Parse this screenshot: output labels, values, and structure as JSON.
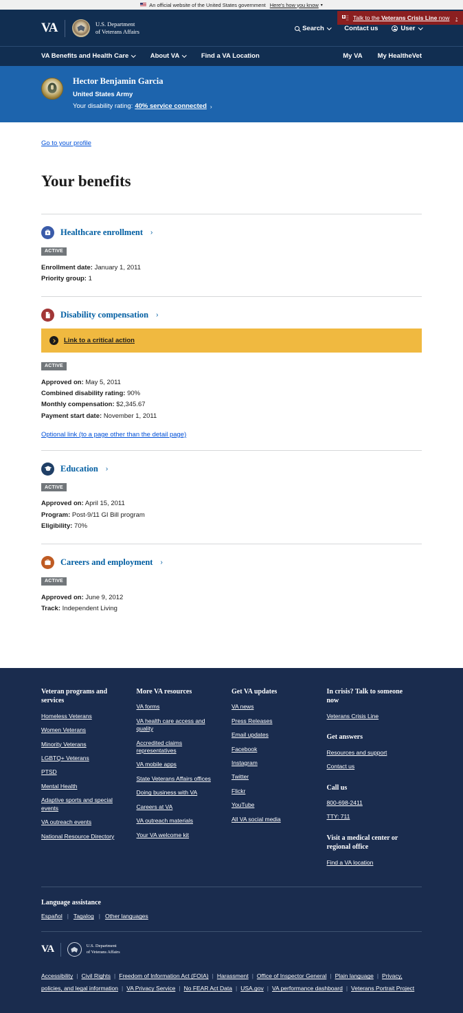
{
  "gov_banner": {
    "text": "An official website of the United States government",
    "hint": "Here's how you know",
    "flag_icon": "us-flag-icon",
    "caret_icon": "chevron-down-icon"
  },
  "crisis_line": {
    "prefix": "Talk to the",
    "emphasis": "Veterans Crisis Line",
    "suffix": "now",
    "icon": "crisis-line-icon",
    "chevron": "›",
    "color": "#8b1f20"
  },
  "header": {
    "logo_va": "VA",
    "seal_icon": "va-seal-icon",
    "logo_line1": "U.S. Department",
    "logo_line2": "of Veterans Affairs",
    "links": [
      {
        "label": "Search",
        "icon": "search-icon",
        "caret": true
      },
      {
        "label": "Contact us",
        "icon": null,
        "caret": false
      },
      {
        "label": "User",
        "icon": "user-icon",
        "caret": true
      }
    ],
    "nav_left": [
      {
        "label": "VA Benefits and Health Care",
        "caret": true
      },
      {
        "label": "About VA",
        "caret": true
      },
      {
        "label": "Find a VA Location",
        "caret": false
      }
    ],
    "nav_right": [
      {
        "label": "My VA"
      },
      {
        "label": "My HealtheVet"
      }
    ],
    "background": "#112e51"
  },
  "profile_banner": {
    "seal_icon": "army-seal-icon",
    "name": "Hector Benjamin Garcia",
    "branch": "United States Army",
    "rating_label": "Your disability rating:",
    "rating_link": "40% service connected",
    "chevron": "›",
    "background": "#1d64ad"
  },
  "main": {
    "profile_link": "Go to your profile",
    "page_title": "Your benefits",
    "benefits": [
      {
        "id": "healthcare-enrollment",
        "title": "Healthcare enrollment",
        "icon": "medical-bag-icon",
        "icon_color": "#3a5ba9",
        "chevron": "›",
        "status": "ACTIVE",
        "critical_action": null,
        "details": [
          {
            "key": "Enrollment date:",
            "value": "January 1, 2011"
          },
          {
            "key": "Priority group:",
            "value": "1"
          }
        ],
        "optional_link": null
      },
      {
        "id": "disability-compensation",
        "title": "Disability compensation",
        "icon": "document-icon",
        "icon_color": "#a23737",
        "chevron": "›",
        "status": "ACTIVE",
        "critical_action": {
          "label": "Link to a critical action",
          "icon": "chevron-right-circle-icon",
          "background": "#f0b940"
        },
        "details": [
          {
            "key": "Approved on:",
            "value": "May 5, 2011"
          },
          {
            "key": "Combined disability rating:",
            "value": "90%"
          },
          {
            "key": "Monthly compensation:",
            "value": "$2,345.67"
          },
          {
            "key": "Payment start date:",
            "value": "November 1, 2011"
          }
        ],
        "optional_link": "Optional link (to a page other than the detail page)"
      },
      {
        "id": "education",
        "title": "Education",
        "icon": "graduation-cap-icon",
        "icon_color": "#1f3f66",
        "chevron": "›",
        "status": "ACTIVE",
        "critical_action": null,
        "details": [
          {
            "key": "Approved on:",
            "value": "April 15, 2011"
          },
          {
            "key": "Program:",
            "value": "Post-9/11 GI Bill program"
          },
          {
            "key": "Eligibility:",
            "value": "70%"
          }
        ],
        "optional_link": null
      },
      {
        "id": "careers-and-employment",
        "title": "Careers and employment",
        "icon": "briefcase-icon",
        "icon_color": "#bf5b23",
        "chevron": "›",
        "status": "ACTIVE",
        "critical_action": null,
        "details": [
          {
            "key": "Approved on:",
            "value": "June 9, 2012"
          },
          {
            "key": "Track:",
            "value": "Independent Living"
          }
        ],
        "optional_link": null
      }
    ]
  },
  "footer": {
    "background": "#1a2c4e",
    "columns": [
      {
        "heading": "Veteran programs and services",
        "links": [
          "Homeless Veterans",
          "Women Veterans",
          "Minority Veterans",
          "LGBTQ+ Veterans",
          "PTSD",
          "Mental Health",
          "Adaptive sports and special events",
          "VA outreach events",
          "National Resource Directory"
        ]
      },
      {
        "heading": "More VA resources",
        "links": [
          "VA forms",
          "VA health care access and quality",
          "Accredited claims representatives",
          "VA mobile apps",
          "State Veterans Affairs offices",
          "Doing business with VA",
          "Careers at VA",
          "VA outreach materials",
          "Your VA welcome kit"
        ]
      },
      {
        "heading": "Get VA updates",
        "links": [
          "VA news",
          "Press Releases",
          "Email updates",
          "Facebook",
          "Instagram",
          "Twitter",
          "Flickr",
          "YouTube",
          "All VA social media"
        ]
      }
    ],
    "support_groups": [
      {
        "heading": "In crisis? Talk to someone now",
        "links": [
          "Veterans Crisis Line"
        ]
      },
      {
        "heading": "Get answers",
        "links": [
          "Resources and support",
          "Contact us"
        ]
      },
      {
        "heading": "Call us",
        "links": [
          "800-698-2411",
          "TTY: 711"
        ]
      },
      {
        "heading": "Visit a medical center or regional office",
        "links": [
          "Find a VA location"
        ]
      }
    ],
    "language": {
      "heading": "Language assistance",
      "links": [
        "Español",
        "Tagalog",
        "Other languages"
      ]
    },
    "logo_va": "VA",
    "seal_icon": "va-seal-icon",
    "logo_line1": "U.S. Department",
    "logo_line2": "of Veterans Affairs",
    "bottom_links": [
      "Accessibility",
      "Civil Rights",
      "Freedom of Information Act (FOIA)",
      "Harassment",
      "Office of Inspector General",
      "Plain language",
      "Privacy, policies, and legal information",
      "VA Privacy Service",
      "No FEAR Act Data",
      "USA.gov",
      "VA performance dashboard",
      "Veterans Portrait Project"
    ]
  }
}
